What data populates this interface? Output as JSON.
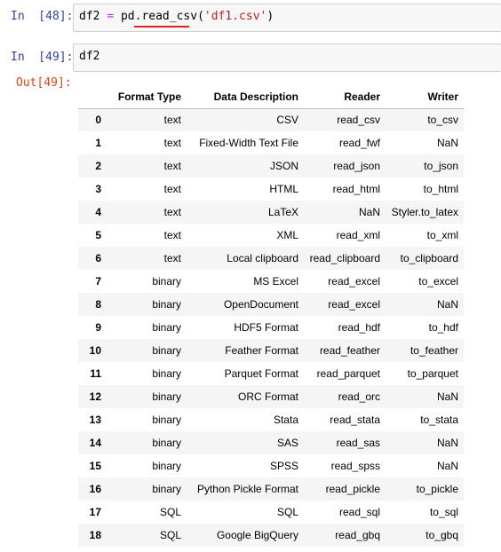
{
  "cells": [
    {
      "prompt": "In  [48]:",
      "code_parts": [
        "df2 ",
        "=",
        " pd.",
        "read_csv",
        "(",
        "'df1.csv'",
        ")"
      ]
    },
    {
      "prompt": "In  [49]:",
      "code": "df2"
    }
  ],
  "output_prompt": "Out[49]:",
  "table": {
    "columns": [
      "",
      "Format Type",
      "Data Description",
      "Reader",
      "Writer"
    ],
    "rows": [
      [
        "0",
        "text",
        "CSV",
        "read_csv",
        "to_csv"
      ],
      [
        "1",
        "text",
        "Fixed-Width Text File",
        "read_fwf",
        "NaN"
      ],
      [
        "2",
        "text",
        "JSON",
        "read_json",
        "to_json"
      ],
      [
        "3",
        "text",
        "HTML",
        "read_html",
        "to_html"
      ],
      [
        "4",
        "text",
        "LaTeX",
        "NaN",
        "Styler.to_latex"
      ],
      [
        "5",
        "text",
        "XML",
        "read_xml",
        "to_xml"
      ],
      [
        "6",
        "text",
        "Local clipboard",
        "read_clipboard",
        "to_clipboard"
      ],
      [
        "7",
        "binary",
        "MS Excel",
        "read_excel",
        "to_excel"
      ],
      [
        "8",
        "binary",
        "OpenDocument",
        "read_excel",
        "NaN"
      ],
      [
        "9",
        "binary",
        "HDF5 Format",
        "read_hdf",
        "to_hdf"
      ],
      [
        "10",
        "binary",
        "Feather Format",
        "read_feather",
        "to_feather"
      ],
      [
        "11",
        "binary",
        "Parquet Format",
        "read_parquet",
        "to_parquet"
      ],
      [
        "12",
        "binary",
        "ORC Format",
        "read_orc",
        "NaN"
      ],
      [
        "13",
        "binary",
        "Stata",
        "read_stata",
        "to_stata"
      ],
      [
        "14",
        "binary",
        "SAS",
        "read_sas",
        "NaN"
      ],
      [
        "15",
        "binary",
        "SPSS",
        "read_spss",
        "NaN"
      ],
      [
        "16",
        "binary",
        "Python Pickle Format",
        "read_pickle",
        "to_pickle"
      ],
      [
        "17",
        "SQL",
        "SQL",
        "read_sql",
        "to_sql"
      ],
      [
        "18",
        "SQL",
        "Google BigQuery",
        "read_gbq",
        "to_gbq"
      ]
    ]
  },
  "colors": {
    "in_prompt": "#303F9F",
    "out_prompt": "#D84315",
    "operator": "#AA22FF",
    "string": "#BA2121",
    "annotation_underline": "#e02020",
    "stripe": "#f5f5f5"
  }
}
